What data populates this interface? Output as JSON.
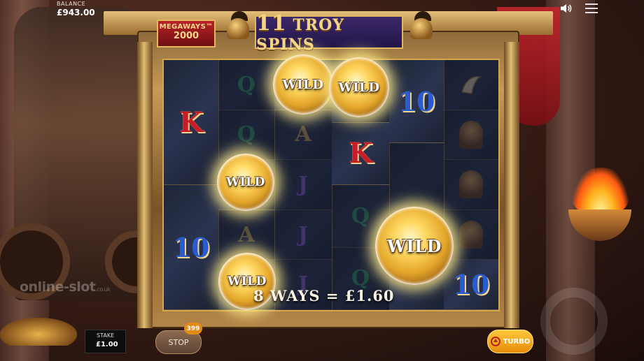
{
  "header": {
    "balance_label": "BALANCE",
    "balance_value": "£943.00",
    "sound_icon": "speaker-icon",
    "menu_icon": "hamburger-menu-icon"
  },
  "logo": {
    "line1": "MEGAWAYS™",
    "line2": "2000"
  },
  "banner": {
    "count": "11",
    "text": "TROY SPINS"
  },
  "reels": [
    [
      {
        "symbol": "K",
        "dim": false
      },
      {
        "symbol": "10",
        "dim": false
      }
    ],
    [
      {
        "symbol": "Q",
        "dim": true
      },
      {
        "symbol": "Q",
        "dim": true
      },
      {
        "symbol": "blank",
        "dim": false
      },
      {
        "symbol": "A",
        "dim": true
      },
      {
        "symbol": "blank",
        "dim": false
      }
    ],
    [
      {
        "symbol": "blank",
        "dim": false
      },
      {
        "symbol": "A",
        "dim": true
      },
      {
        "symbol": "J",
        "dim": true
      },
      {
        "symbol": "J",
        "dim": true
      },
      {
        "symbol": "J",
        "dim": true
      }
    ],
    [
      {
        "symbol": "blank",
        "dim": false
      },
      {
        "symbol": "K",
        "dim": false
      },
      {
        "symbol": "Q",
        "dim": true
      },
      {
        "symbol": "Q",
        "dim": true
      }
    ],
    [
      {
        "symbol": "10",
        "dim": false
      },
      {
        "symbol": "blank",
        "dim": true
      },
      {
        "symbol": "blank",
        "dim": false
      }
    ],
    [
      {
        "symbol": "horn",
        "dim": true
      },
      {
        "symbol": "warrior",
        "dim": true
      },
      {
        "symbol": "warrior",
        "dim": true
      },
      {
        "symbol": "warrior",
        "dim": true
      },
      {
        "symbol": "10",
        "dim": false
      }
    ]
  ],
  "wild_label": "WILD",
  "win_text": "8 WAYS = £1.60",
  "footer": {
    "stake_label": "STAKE",
    "stake_value": "£1.00",
    "stop_label": "STOP",
    "spins_left": "399",
    "turbo_label": "TURBO"
  },
  "watermark": {
    "text": "online-slot",
    "suffix": ".co.uk"
  },
  "colors": {
    "gold": "#d6a64e",
    "banner_bg": "#2d1d5a",
    "turbo": "#f5a623",
    "stop": "#6e5240"
  }
}
